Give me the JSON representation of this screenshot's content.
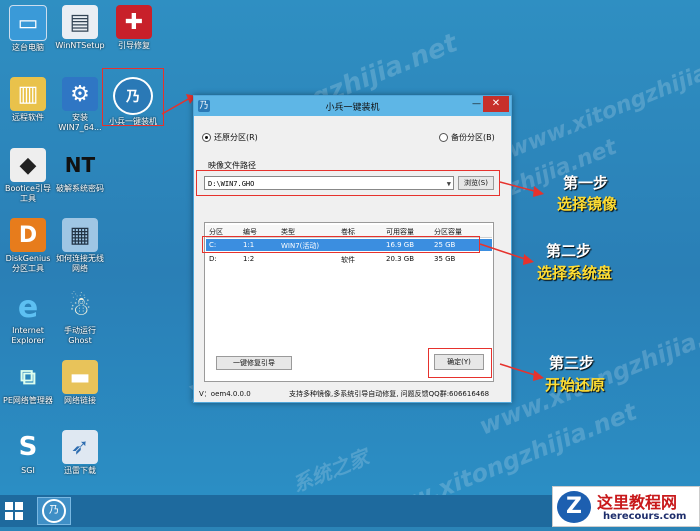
{
  "desktop_icons": [
    {
      "label": "这台电脑",
      "icon": "computer-icon"
    },
    {
      "label": "WinNTSetup",
      "icon": "setup-icon"
    },
    {
      "label": "引导修复",
      "icon": "toolbox-icon"
    },
    {
      "label": "远程软件",
      "icon": "remote-icon"
    },
    {
      "label": "安装\nWIN7_64...",
      "icon": "install-gear-icon"
    },
    {
      "label": "小兵一键装机",
      "icon": "xiaobing-icon"
    },
    {
      "label": "Bootice引导\n工具",
      "icon": "bootice-icon"
    },
    {
      "label": "破解系统密码",
      "icon": "nt-password-icon"
    },
    {
      "label": "DiskGenius\n分区工具",
      "icon": "diskgenius-icon"
    },
    {
      "label": "如何连接无线\n网络",
      "icon": "wifi-help-icon"
    },
    {
      "label": "Internet\nExplorer",
      "icon": "ie-icon"
    },
    {
      "label": "手动运行\nGhost",
      "icon": "ghost-icon"
    },
    {
      "label": "PE网络管理器",
      "icon": "network-manager-icon"
    },
    {
      "label": "网络链接",
      "icon": "network-folder-icon"
    },
    {
      "label": "SGI",
      "icon": "sgi-icon"
    },
    {
      "label": "迅雷下载",
      "icon": "thunder-icon"
    }
  ],
  "window": {
    "title": "小兵一键装机",
    "radio_restore": "还原分区(R)",
    "radio_backup": "备份分区(B)",
    "image_path_label": "映像文件路径",
    "image_path_value": "D:\\WIN7.GHO",
    "browse_button": "浏览(S)",
    "table_headers": [
      "分区",
      "编号",
      "类型",
      "卷标",
      "可用容量",
      "分区容量"
    ],
    "rows": [
      {
        "drive": "C:",
        "num": "1:1",
        "type": "WIN7(活动)",
        "label": "",
        "free": "16.9 GB",
        "size": "25 GB",
        "selected": true
      },
      {
        "drive": "D:",
        "num": "1:2",
        "type": "",
        "label": "软件",
        "free": "20.3 GB",
        "size": "35 GB",
        "selected": false
      }
    ],
    "repair_button": "一键修复引导",
    "ok_button": "确定(Y)",
    "version": "V：oem4.0.0.0",
    "status_text": "支持多种镜像,多系统引导自动修复, 问题反馈QQ群:606616468"
  },
  "callouts": {
    "step1": "第一步",
    "step1_action": "选择镜像",
    "step2": "第二步",
    "step2_action": "选择系统盘",
    "step3": "第三步",
    "step3_action": "开始还原"
  },
  "watermarks": [
    "xitongzhijia.net",
    "系统之家 www.xitongzhijia.net",
    "系统之家",
    "www.xitongzhijia.net"
  ],
  "logo": {
    "title": "这里教程网",
    "url": "herecours.com",
    "mark": "Z"
  },
  "colors": {
    "accent_red": "#e6322d",
    "selected_row": "#3b8ee0",
    "desktop_blue": "#2b84b7"
  }
}
